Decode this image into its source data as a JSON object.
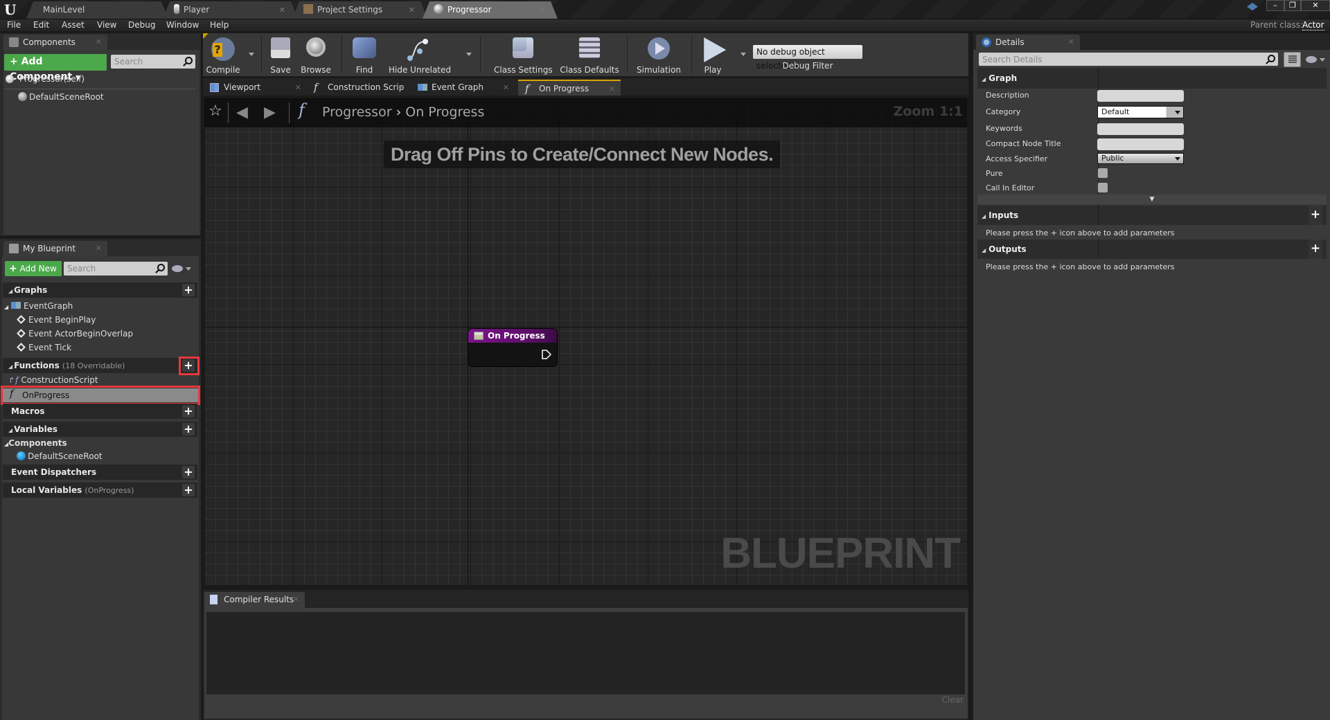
{
  "window": {
    "tabs": [
      {
        "label": "MainLevel",
        "active": false
      },
      {
        "label": "Player",
        "active": false
      },
      {
        "label": "Project Settings",
        "active": false
      },
      {
        "label": "Progressor",
        "active": true
      }
    ],
    "controls": {
      "minimize": "–",
      "restore": "❐",
      "close": "✕"
    },
    "parent_class_label": "Parent class:",
    "parent_class_value": "Actor"
  },
  "menu": [
    "File",
    "Edit",
    "Asset",
    "View",
    "Debug",
    "Window",
    "Help"
  ],
  "components_panel": {
    "tab_label": "Components",
    "add_button": "+ Add Component",
    "search_placeholder": "Search",
    "items": [
      {
        "label": "Progressor(self)"
      },
      {
        "label": "DefaultSceneRoot"
      }
    ]
  },
  "my_blueprint": {
    "tab_label": "My Blueprint",
    "add_button": "Add New",
    "search_placeholder": "Search",
    "sections": {
      "graphs": {
        "label": "Graphs"
      },
      "functions": {
        "label": "Functions",
        "sub": "(18 Overridable)"
      },
      "macros": {
        "label": "Macros"
      },
      "variables": {
        "label": "Variables"
      },
      "components": {
        "label": "Components"
      },
      "event_dispatchers": {
        "label": "Event Dispatchers"
      },
      "local_variables": {
        "label": "Local Variables",
        "sub": "(OnProgress)"
      }
    },
    "graph_items": [
      "EventGraph",
      "Event BeginPlay",
      "Event ActorBeginOverlap",
      "Event Tick"
    ],
    "function_items": [
      "ConstructionScript",
      "OnProgress"
    ],
    "component_items": [
      "DefaultSceneRoot"
    ]
  },
  "toolbar": {
    "buttons": [
      "Compile",
      "Save",
      "Browse",
      "Find",
      "Hide Unrelated",
      "Class Settings",
      "Class Defaults",
      "Simulation",
      "Play"
    ],
    "debug_select": "No debug object selected",
    "debug_label": "Debug Filter"
  },
  "graph_tabs": [
    {
      "label": "Viewport",
      "active": false
    },
    {
      "label": "Construction Scrip",
      "active": false
    },
    {
      "label": "Event Graph",
      "active": false
    },
    {
      "label": "On Progress",
      "active": true
    }
  ],
  "graph": {
    "breadcrumb_root": "Progressor",
    "breadcrumb_sep": "›",
    "breadcrumb_current": "On Progress",
    "zoom": "Zoom 1:1",
    "hint": "Drag Off Pins to Create/Connect New Nodes.",
    "watermark": "BLUEPRINT",
    "node_title": "On Progress",
    "node_color": "#7a158a"
  },
  "compiler": {
    "tab_label": "Compiler Results",
    "clear_label": "Clear"
  },
  "details": {
    "tab_label": "Details",
    "search_placeholder": "Search Details",
    "graph_section": "Graph",
    "rows": [
      {
        "label": "Description",
        "type": "text",
        "value": ""
      },
      {
        "label": "Category",
        "type": "combo",
        "value": "Default"
      },
      {
        "label": "Keywords",
        "type": "text",
        "value": ""
      },
      {
        "label": "Compact Node Title",
        "type": "text",
        "value": ""
      },
      {
        "label": "Access Specifier",
        "type": "combo",
        "value": "Public"
      },
      {
        "label": "Pure",
        "type": "check",
        "value": false
      },
      {
        "label": "Call In Editor",
        "type": "check",
        "value": false
      }
    ],
    "inputs_section": "Inputs",
    "inputs_note": "Please press the + icon above to add parameters",
    "outputs_section": "Outputs",
    "outputs_note": "Please press the + icon above to add parameters"
  },
  "colors": {
    "accent_green": "#4ba84b",
    "highlight_red": "#e8383d",
    "active_tab_gold": "#d9a400"
  }
}
